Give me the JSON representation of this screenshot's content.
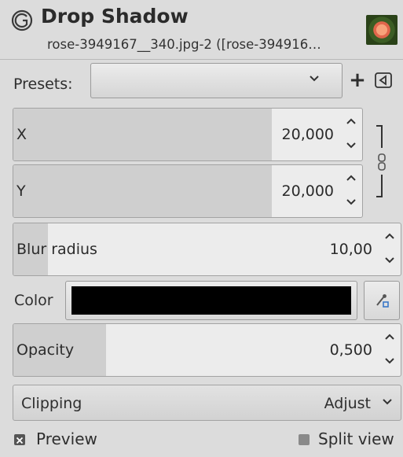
{
  "header": {
    "title": "Drop Shadow",
    "subtitle": "rose-3949167__340.jpg-2 ([rose-394916…"
  },
  "presets": {
    "label": "Presets:",
    "value": "",
    "add_label": "+"
  },
  "fields": {
    "x": {
      "label": "X",
      "value": "20,000",
      "fill_fraction": 0.74
    },
    "y": {
      "label": "Y",
      "value": "20,000",
      "fill_fraction": 0.74
    },
    "blur": {
      "label": "Blur radius",
      "value": "10,00",
      "fill_fraction": 0.09
    },
    "opacity": {
      "label": "Opacity",
      "value": "0,500",
      "fill_fraction": 0.24
    }
  },
  "color": {
    "label": "Color",
    "swatch": "#000000"
  },
  "clipping": {
    "label": "Clipping",
    "value": "Adjust"
  },
  "options": {
    "preview": {
      "label": "Preview",
      "checked": true
    },
    "split_view": {
      "label": "Split view",
      "checked": false
    }
  }
}
